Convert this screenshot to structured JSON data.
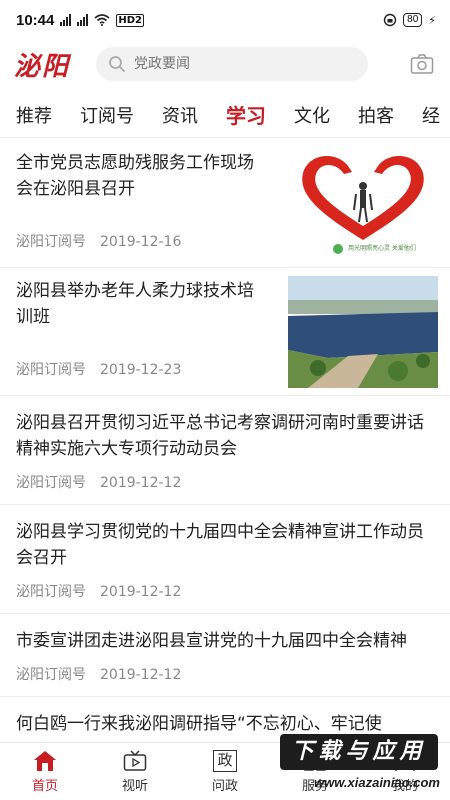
{
  "status_bar": {
    "time": "10:44",
    "network": "4G",
    "hd_label": "HD2",
    "battery": "80"
  },
  "header": {
    "logo": "泌阳",
    "search_placeholder": "党政要闻",
    "brand_color": "#c81d23"
  },
  "tabs": [
    {
      "label": "推荐"
    },
    {
      "label": "订阅号"
    },
    {
      "label": "资讯"
    },
    {
      "label": "学习",
      "active": true
    },
    {
      "label": "文化"
    },
    {
      "label": "拍客"
    },
    {
      "label": "经"
    }
  ],
  "news": [
    {
      "title": "全市党员志愿助残服务工作现场会在泌阳县召开",
      "source": "泌阳订阅号",
      "date": "2019-12-16",
      "thumb_caption": "用光明照亮心灵 关爱他们"
    },
    {
      "title": "泌阳县举办老年人柔力球技术培训班",
      "source": "泌阳订阅号",
      "date": "2019-12-23"
    },
    {
      "title": "泌阳县召开贯彻习近平总书记考察调研河南时重要讲话精神实施六大专项行动动员会",
      "source": "泌阳订阅号",
      "date": "2019-12-12"
    },
    {
      "title": "泌阳县学习贯彻党的十九届四中全会精神宣讲工作动员会召开",
      "source": "泌阳订阅号",
      "date": "2019-12-12"
    },
    {
      "title": "市委宣讲团走进泌阳县宣讲党的十九届四中全会精神",
      "source": "泌阳订阅号",
      "date": "2019-12-12"
    },
    {
      "title": "何白鸥一行来我泌阳调研指导“不忘初心、牢记使"
    }
  ],
  "bottom_nav": [
    {
      "label": "首页",
      "icon": "home-icon",
      "active": true
    },
    {
      "label": "视听",
      "icon": "tv-icon"
    },
    {
      "label": "问政",
      "icon": "zheng-icon",
      "icon_char": "政"
    },
    {
      "label": "服务",
      "icon": "service-icon"
    },
    {
      "label": "我的",
      "icon": "user-icon"
    }
  ],
  "watermark": {
    "text": "下载与应用",
    "url": "www.xiazainiao.com"
  }
}
